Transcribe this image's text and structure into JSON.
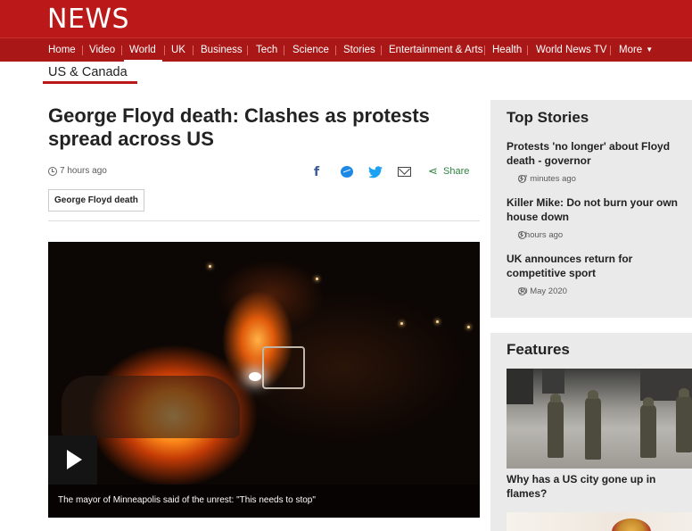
{
  "brand": {
    "logo_text": "NEWS",
    "primary_color": "#bb1919",
    "nav_color": "#a91717"
  },
  "nav": {
    "items": [
      "Home",
      "Video",
      "World",
      "UK",
      "Business",
      "Tech",
      "Science",
      "Stories",
      "Entertainment & Arts",
      "Health",
      "World News TV"
    ],
    "more_label": "More",
    "active": "World"
  },
  "section": {
    "title": "US & Canada"
  },
  "article": {
    "headline": "George Floyd death: Clashes as protests spread across US",
    "timestamp": "7 hours ago",
    "share_label": "Share",
    "share_icons": [
      "facebook-icon",
      "messenger-icon",
      "twitter-icon",
      "email-icon",
      "share-icon"
    ],
    "topic_tag": "George Floyd death",
    "media_caption": "The mayor of Minneapolis said of the unrest: \"This needs to stop\""
  },
  "sidebar": {
    "top_stories": {
      "title": "Top Stories",
      "items": [
        {
          "title": "Protests 'no longer' about Floyd death - governor",
          "time": "37 minutes ago"
        },
        {
          "title": "Killer Mike: Do not burn your own house down",
          "time": "3 hours ago"
        },
        {
          "title": "UK announces return for competitive sport",
          "time": "30 May 2020"
        }
      ]
    },
    "features": {
      "title": "Features",
      "items": [
        {
          "title": "Why has a US city gone up in flames?"
        }
      ]
    }
  }
}
